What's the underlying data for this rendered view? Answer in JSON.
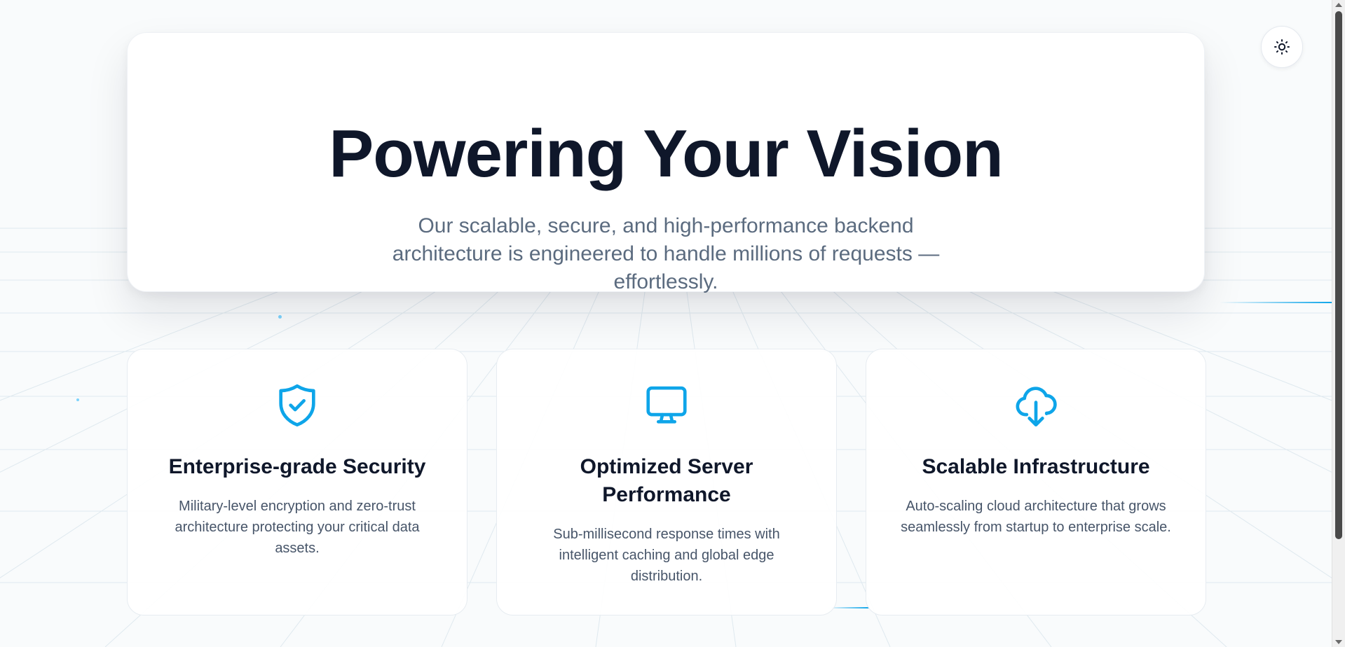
{
  "hero": {
    "title": "Powering Your Vision",
    "subtitle": "Our scalable, secure, and high-performance backend architecture is engineered to handle millions of requests — effortlessly."
  },
  "theme_toggle": {
    "icon": "sun-icon"
  },
  "features": [
    {
      "icon": "shield-check-icon",
      "title": "Enterprise-grade Security",
      "description": "Military-level encryption and zero-trust architecture protecting your critical data assets."
    },
    {
      "icon": "monitor-icon",
      "title": "Optimized Server Performance",
      "description": "Sub-millisecond response times with intelligent caching and global edge distribution."
    },
    {
      "icon": "cloud-download-icon",
      "title": "Scalable Infrastructure",
      "description": "Auto-scaling cloud architecture that grows seamlessly from startup to enterprise scale."
    }
  ],
  "colors": {
    "accent": "#0ea5e9",
    "heading": "#0f172a",
    "body_text": "#475569",
    "subtitle_text": "#5b6b7f",
    "background": "#f9fbfc"
  }
}
